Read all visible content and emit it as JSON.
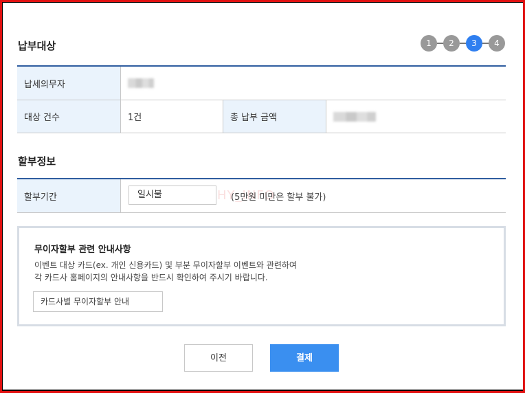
{
  "payment_target": {
    "section_title": "납부대상",
    "taxpayer_label": "납세의무자",
    "count_label": "대상 건수",
    "count_value": "1건",
    "total_label": "총 납부 금액"
  },
  "steps": [
    {
      "label": "1",
      "active": false
    },
    {
      "label": "2",
      "active": false
    },
    {
      "label": "3",
      "active": true
    },
    {
      "label": "4",
      "active": false
    }
  ],
  "installment": {
    "section_title": "할부정보",
    "period_label": "할부기간",
    "period_value": "일시불",
    "note": "(5만원 미만은 할부 불가)"
  },
  "info_box": {
    "title": "무이자할부 관련 안내사항",
    "line1": "이벤트 대상 카드(ex. 개인 신용카드) 및 부분 무이자할부 이벤트와 관련하여",
    "line2": "각 카드사 홈페이지의 안내사항을 반드시 확인하여 주시기 바랍니다.",
    "guide_button": "카드사별 무이자할부 안내"
  },
  "buttons": {
    "prev": "이전",
    "pay": "결제"
  },
  "colors": {
    "accent": "#3a8ff0",
    "header_bg": "#eaf3fc",
    "table_top_border": "#2f5d9f",
    "frame": "#e01010"
  }
}
